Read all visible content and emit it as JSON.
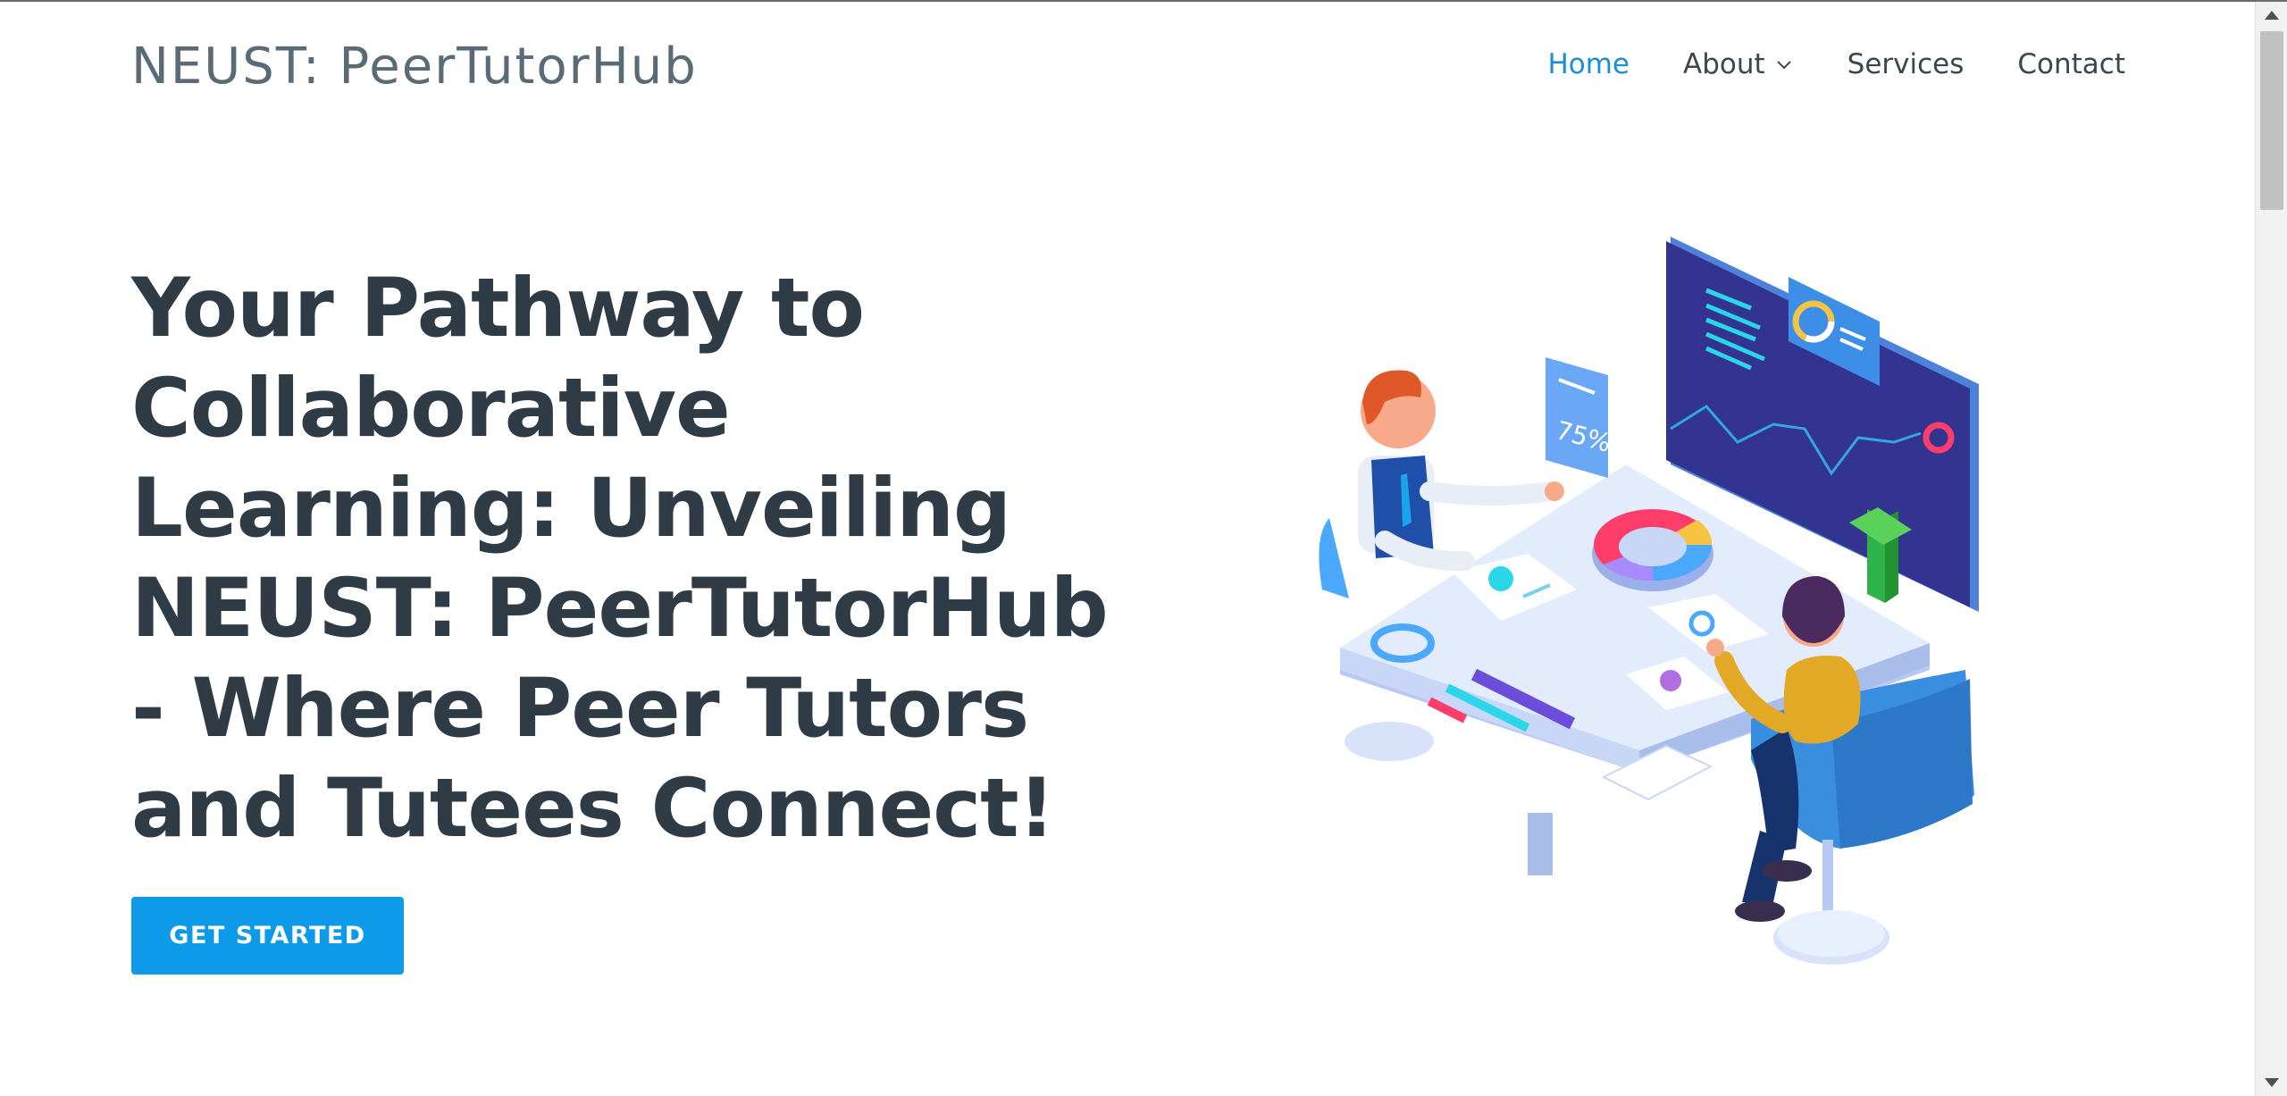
{
  "header": {
    "logo": "NEUST: PeerTutorHub",
    "nav": [
      {
        "label": "Home",
        "active": true
      },
      {
        "label": "About",
        "has_dropdown": true
      },
      {
        "label": "Services"
      },
      {
        "label": "Contact"
      }
    ]
  },
  "hero": {
    "title": "Your Pathway to Collaborative Learning: Unveiling NEUST: PeerTutorHub - Where Peer Tutors and Tutees Connect!",
    "cta_label": "GET STARTED"
  },
  "illustration": {
    "percent_card": "75%"
  },
  "colors": {
    "accent": "#0d9ae8",
    "nav_active": "#1a8fd6",
    "title": "#2f3c46",
    "logo": "#5a6b78"
  },
  "icons": [
    "chevron-down-icon"
  ]
}
